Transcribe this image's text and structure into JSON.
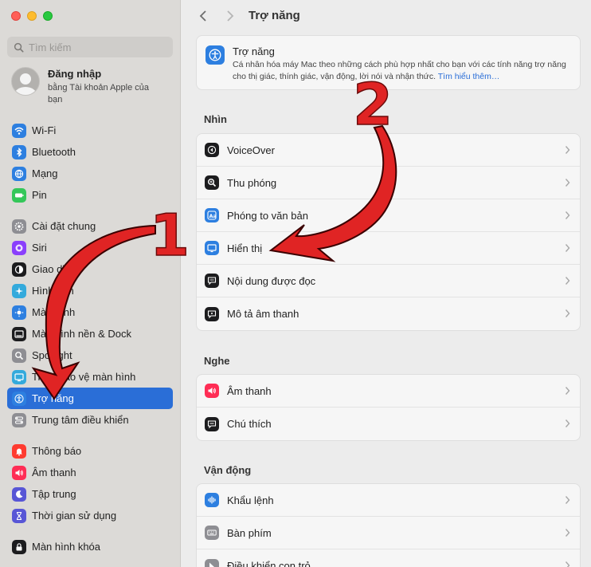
{
  "sidebar": {
    "search_placeholder": "Tìm kiếm",
    "account": {
      "title": "Đăng nhập",
      "subtitle": "bằng Tài khoản Apple của bạn"
    },
    "group1": [
      {
        "label": "Wi-Fi",
        "icon": "wifi-icon",
        "color": "#2d7fe0"
      },
      {
        "label": "Bluetooth",
        "icon": "bluetooth-icon",
        "color": "#2d7fe0"
      },
      {
        "label": "Mạng",
        "icon": "globe-icon",
        "color": "#2d7fe0"
      },
      {
        "label": "Pin",
        "icon": "battery-icon",
        "color": "#34c759"
      }
    ],
    "group2": [
      {
        "label": "Cài đặt chung",
        "icon": "gear-icon",
        "color": "#8e8e93"
      },
      {
        "label": "Siri",
        "icon": "siri-icon",
        "color": "#8a3ffc"
      },
      {
        "label": "Giao diện",
        "icon": "appearance-icon",
        "color": "#1c1c1e"
      },
      {
        "label": "Hình nền",
        "icon": "wallpaper-icon",
        "color": "#34aadc"
      },
      {
        "label": "Màn hình",
        "icon": "display-icon",
        "color": "#2d7fe0"
      },
      {
        "label": "Màn hình nền & Dock",
        "icon": "dock-icon",
        "color": "#1c1c1e"
      },
      {
        "label": "Spotlight",
        "icon": "spotlight-icon",
        "color": "#8e8e93"
      },
      {
        "label": "Trình bảo vệ màn hình",
        "icon": "screensaver-icon",
        "color": "#34aadc"
      },
      {
        "label": "Trợ năng",
        "icon": "accessibility-icon",
        "color": "#2d7fe0",
        "active": true
      },
      {
        "label": "Trung tâm điều khiển",
        "icon": "control-center-icon",
        "color": "#8e8e93"
      }
    ],
    "group3": [
      {
        "label": "Thông báo",
        "icon": "bell-icon",
        "color": "#ff3b30"
      },
      {
        "label": "Âm thanh",
        "icon": "speaker-icon",
        "color": "#ff2d55"
      },
      {
        "label": "Tập trung",
        "icon": "moon-icon",
        "color": "#5856d6"
      },
      {
        "label": "Thời gian sử dụng",
        "icon": "hourglass-icon",
        "color": "#5856d6"
      }
    ],
    "group4": [
      {
        "label": "Màn hình khóa",
        "icon": "lock-icon",
        "color": "#1c1c1e"
      }
    ]
  },
  "main": {
    "title": "Trợ năng",
    "hero": {
      "title": "Trợ năng",
      "description": "Cá nhân hóa máy Mac theo những cách phù hợp nhất cho bạn với các tính năng trợ năng cho thị giác, thính giác, vận động, lời nói và nhận thức.",
      "link": "Tìm hiểu thêm…"
    },
    "sections": [
      {
        "title": "Nhìn",
        "rows": [
          {
            "label": "VoiceOver",
            "icon": "voiceover-icon",
            "color": "#1c1c1e"
          },
          {
            "label": "Thu phóng",
            "icon": "zoom-icon",
            "color": "#1c1c1e"
          },
          {
            "label": "Phóng to văn bản",
            "icon": "text-zoom-icon",
            "color": "#2d7fe0"
          },
          {
            "label": "Hiển thị",
            "icon": "monitor-icon",
            "color": "#2d7fe0"
          },
          {
            "label": "Nội dung được đọc",
            "icon": "speech-bubble-icon",
            "color": "#1c1c1e"
          },
          {
            "label": "Mô tả âm thanh",
            "icon": "audio-description-icon",
            "color": "#1c1c1e"
          }
        ]
      },
      {
        "title": "Nghe",
        "rows": [
          {
            "label": "Âm thanh",
            "icon": "speaker-icon",
            "color": "#ff2d55"
          },
          {
            "label": "Chú thích",
            "icon": "captions-icon",
            "color": "#1c1c1e"
          }
        ]
      },
      {
        "title": "Vận động",
        "rows": [
          {
            "label": "Khẩu lệnh",
            "icon": "voice-control-icon",
            "color": "#2d7fe0"
          },
          {
            "label": "Bàn phím",
            "icon": "keyboard-icon",
            "color": "#8e8e93"
          },
          {
            "label": "Điều khiển con trỏ",
            "icon": "pointer-icon",
            "color": "#8e8e93"
          }
        ]
      }
    ]
  },
  "annotations": {
    "marker1": "1",
    "marker2": "2",
    "arrow_color": "#e02424"
  }
}
